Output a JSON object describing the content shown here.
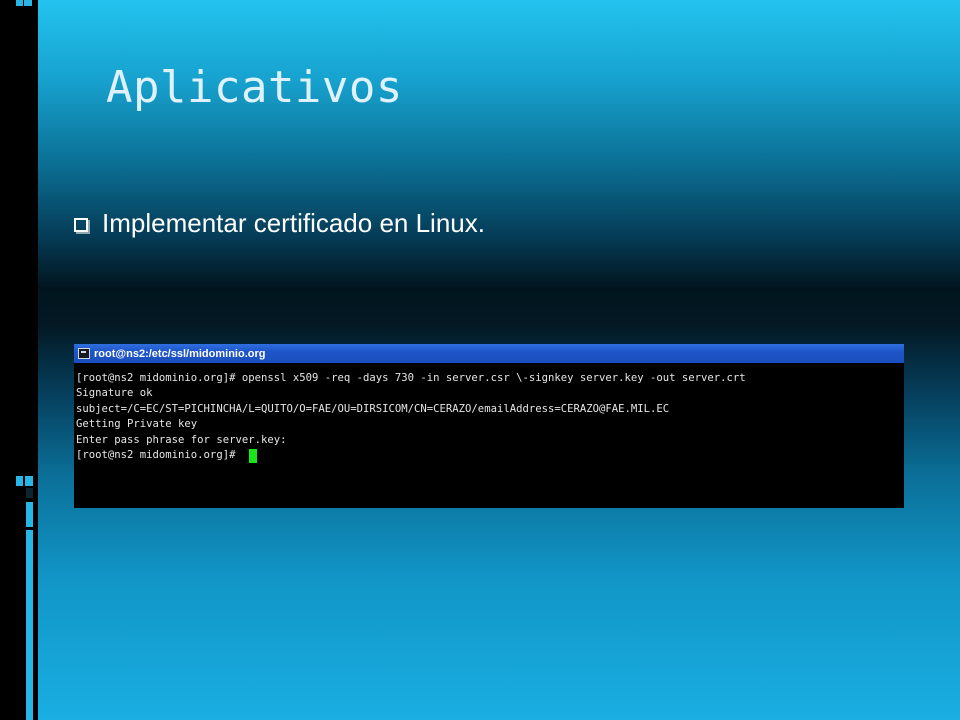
{
  "slide": {
    "title": "Aplicativos",
    "bullets": [
      {
        "text": "Implementar certificado en Linux."
      }
    ]
  },
  "terminal": {
    "window_title": "root@ns2:/etc/ssl/midominio.org",
    "lines": [
      "[root@ns2 midominio.org]# openssl x509 -req -days 730 -in server.csr \\-signkey server.key -out server.crt",
      "Signature ok",
      "subject=/C=EC/ST=PICHINCHA/L=QUITO/O=FAE/OU=DIRSICOM/CN=CERAZO/emailAddress=CERAZO@FAE.MIL.EC",
      "Getting Private key",
      "Enter pass phrase for server.key:",
      "[root@ns2 midominio.org]# "
    ],
    "cursor_color": "#19e619"
  },
  "colors": {
    "title": "#dff2fb",
    "accent": "#23c3ef"
  },
  "icons": {
    "bullet": "square-bullet-icon",
    "terminal": "terminal-icon"
  }
}
